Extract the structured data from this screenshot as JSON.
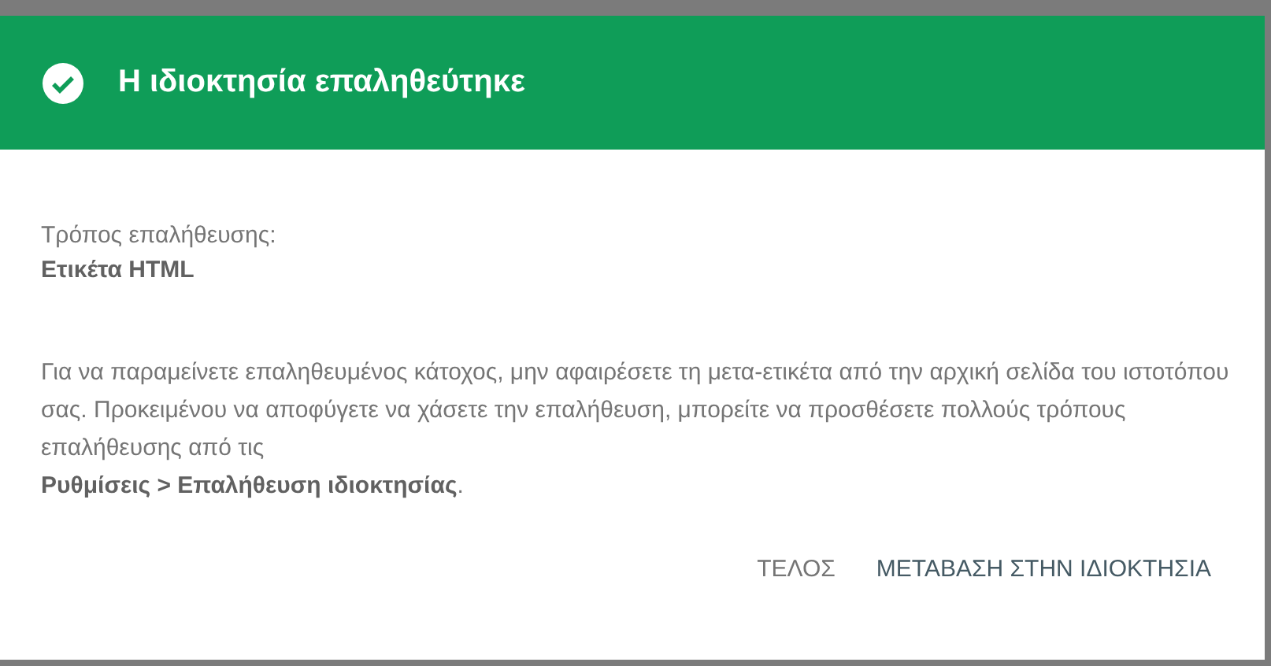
{
  "dialog": {
    "title": "Η ιδιοκτησία επαληθεύτηκε",
    "method_label": "Τρόπος επαλήθευσης:",
    "method_value": "Ετικέτα HTML",
    "paragraph": "Για να παραμείνετε επαληθευμένος κάτοχος, μην αφαιρέσετε τη μετα-ετικέτα από την αρχική σελίδα του ιστοτόπου σας. Προκειμένου να αποφύγετε να χάσετε την επαλήθευση, μπορείτε να προσθέσετε πολλούς τρόπους επαλήθευσης από τις",
    "settings_path": "**Ρυθμίσεις > Επαλήθευση ιδιοκτησίας**.",
    "buttons": [
      {
        "label": "ΤΕΛΟΣ",
        "kind": "secondary"
      },
      {
        "label": "ΜΕΤΑΒΑΣΗ ΣΤΗΝ ΙΔΙΟΚΤΗΣΙΑ",
        "kind": "primary"
      }
    ]
  }
}
